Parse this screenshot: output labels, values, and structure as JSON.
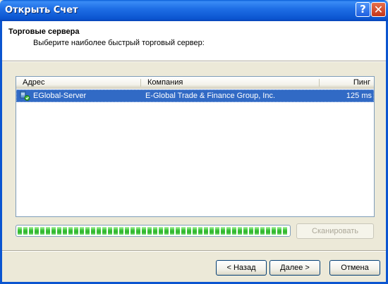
{
  "window": {
    "title": "Открыть Счет",
    "help_label": "?",
    "close_label": "✕"
  },
  "header": {
    "title": "Торговые сервера",
    "subtitle": "Выберите наиболее быстрый торговый сервер:"
  },
  "table": {
    "columns": {
      "address": "Адрес",
      "company": "Компания",
      "ping": "Пинг"
    },
    "rows": [
      {
        "address": "EGlobal-Server",
        "company": "E-Global Trade & Finance Group, Inc.",
        "ping": "125 ms",
        "icon": "server-icon",
        "selected": true
      }
    ]
  },
  "scan": {
    "progress_percent": 100,
    "button_label": "Сканировать",
    "button_enabled": false
  },
  "footer": {
    "back_label": "< Назад",
    "next_label": "Далее >",
    "cancel_label": "Отмена"
  },
  "colors": {
    "titlebar": "#0b55d0",
    "selection": "#316ac5",
    "progress": "#2fb42c",
    "dialog_bg": "#ece9d8"
  }
}
